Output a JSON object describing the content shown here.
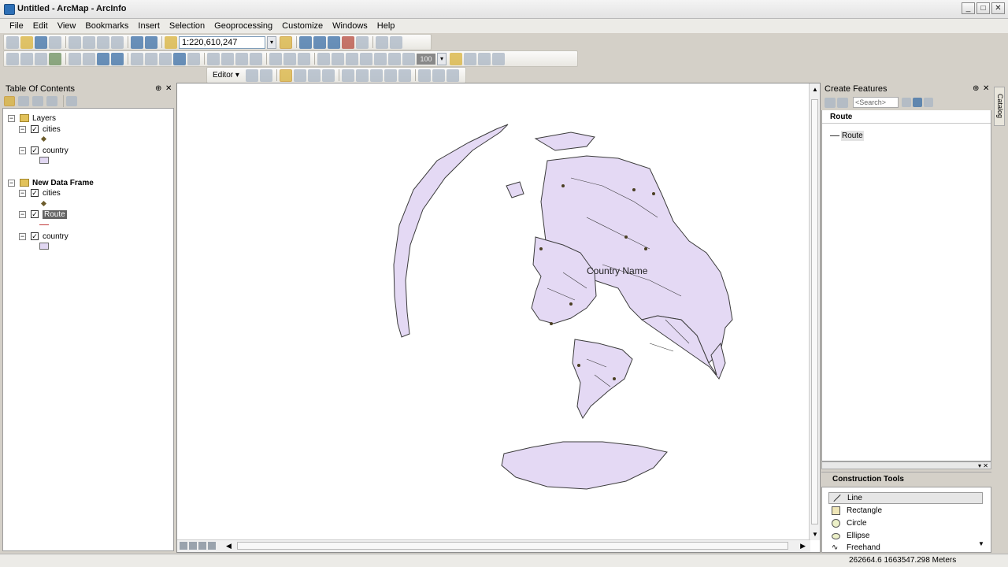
{
  "window": {
    "title": "Untitled - ArcMap - ArcInfo"
  },
  "menu": [
    "File",
    "Edit",
    "View",
    "Bookmarks",
    "Insert",
    "Selection",
    "Geoprocessing",
    "Customize",
    "Windows",
    "Help"
  ],
  "toolbar": {
    "scale": "1:220,610,247",
    "editor_label": "Editor ▾",
    "zoom_percent": "100"
  },
  "toc": {
    "title": "Table Of Contents",
    "frames": [
      {
        "name": "Layers",
        "layers": [
          {
            "name": "cities"
          },
          {
            "name": "country"
          }
        ]
      },
      {
        "name": "New Data Frame",
        "layers": [
          {
            "name": "cities"
          },
          {
            "name": "Route"
          },
          {
            "name": "country"
          }
        ]
      }
    ]
  },
  "map": {
    "label": "Country Name"
  },
  "create_features": {
    "title": "Create Features",
    "search_placeholder": "<Search>",
    "template_group": "Route",
    "template_item": "Route"
  },
  "catalog_tab": "Catalog",
  "construction_tools": {
    "title": "Construction Tools",
    "items": [
      "Line",
      "Rectangle",
      "Circle",
      "Ellipse",
      "Freehand"
    ]
  },
  "status": {
    "coords": "262664.6  1663547.298 Meters"
  },
  "colors": {
    "land": "#e4d9f4",
    "outline": "#3c3c3c",
    "accent": "#f2c64e"
  }
}
